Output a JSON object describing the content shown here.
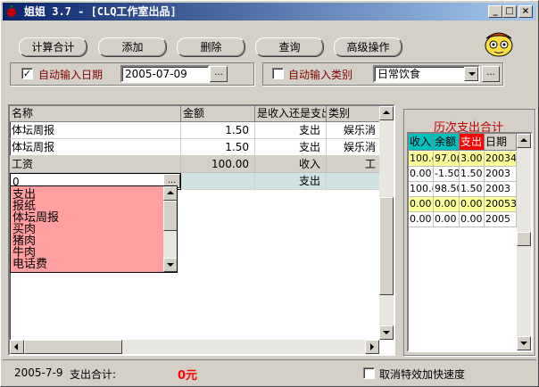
{
  "window": {
    "title": "姐姐 3.7 - [CLQ工作室出品]",
    "min": "_",
    "max": "□",
    "close": "×"
  },
  "toolbar": {
    "calc_label": "计算合计",
    "add_label": "添加",
    "delete_label": "删除",
    "query_label": "查询",
    "advanced_label": "高级操作"
  },
  "options": {
    "auto_date_checked": "✓",
    "auto_date_label": "自动输入日期",
    "date_value": "2005-07-09",
    "ellipsis": "...",
    "auto_category_checked": "",
    "auto_category_label": "自动输入类别",
    "category_value": "日常饮食"
  },
  "grid": {
    "columns": [
      "名称",
      "金额",
      "是收入还是支出",
      "类别"
    ],
    "rows": [
      {
        "name": "体坛周报",
        "amount": "1.50",
        "type": "支出",
        "category": "娱乐消"
      },
      {
        "name": "体坛周报",
        "amount": "1.50",
        "type": "支出",
        "category": "娱乐消"
      },
      {
        "name": "工资",
        "amount": "100.00",
        "type": "收入",
        "category": "工"
      },
      {
        "name": "0",
        "amount": "",
        "type": "支出",
        "category": ""
      }
    ],
    "edit_button": "..."
  },
  "dropdown": {
    "items": [
      "支出",
      "报纸",
      "体坛周报",
      "买肉",
      "猪肉",
      "牛肉",
      "电话费"
    ]
  },
  "history": {
    "title": "历次支出合计",
    "columns": [
      "收入",
      "余额",
      "支出",
      "日期"
    ],
    "rows": [
      [
        "100.(",
        "97.0(",
        "3.00",
        "20034"
      ],
      [
        "0.00",
        "-1.50",
        "1.50",
        "2003"
      ],
      [
        "100.(",
        "98.50",
        "1.50",
        "2003"
      ],
      [
        "0.00",
        "0.00",
        "0.00",
        "20053"
      ],
      [
        "0.00",
        "0.00",
        "0.00",
        "2005"
      ]
    ]
  },
  "status": {
    "date": "2005-7-9",
    "total_label": "支出合计:",
    "total_value": "0元",
    "disable_fx_label": "取消特效加快速度"
  },
  "colors": {
    "title_bar": "#0a246a",
    "total_value": "#ff0000",
    "dropdown_bg": "#ff9f9f",
    "income_header": "#00c0c0",
    "balance_header": "#00c0c0",
    "expense_header": "#ff0000",
    "highlight_row": "#ffff99"
  }
}
